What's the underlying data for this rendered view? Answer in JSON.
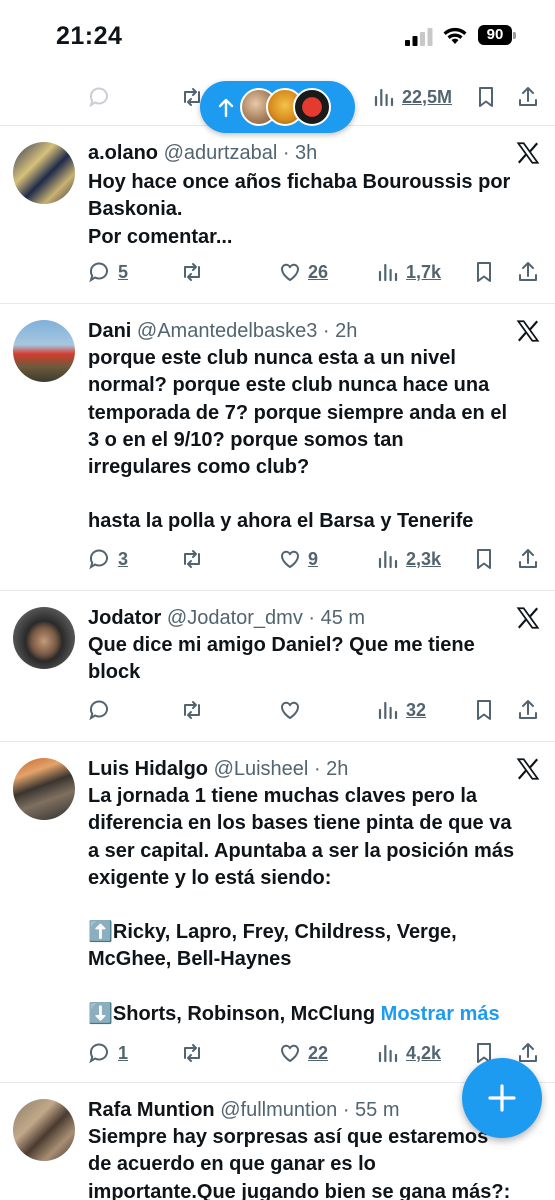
{
  "status_bar": {
    "time": "21:24",
    "battery": "90"
  },
  "prev_tweet": {
    "views": "22,5M"
  },
  "tweets": [
    {
      "name": "a.olano",
      "handle": "@adurtzabal",
      "time": "· 3h",
      "lines": [
        "Hoy hace once años fichaba Bouroussis por",
        "Baskonia.",
        "Por comentar..."
      ],
      "replies": "5",
      "reposts": "",
      "likes": "26",
      "views": "1,7k"
    },
    {
      "name": "Dani",
      "handle": "@Amantedelbaske3",
      "time": "· 2h",
      "lines": [
        "porque este club nunca esta a un nivel",
        "normal? porque este club nunca hace una",
        "temporada de 7? porque siempre anda en el",
        "3 o en el 9/10? porque somos tan",
        "irregulares como club?",
        "",
        "hasta la polla y ahora el Barsa y Tenerife"
      ],
      "replies": "3",
      "reposts": "",
      "likes": "9",
      "views": "2,3k"
    },
    {
      "name": "Jodator",
      "handle": "@Jodator_dmv",
      "time": "· 45 m",
      "lines": [
        "Que dice mi amigo Daniel? Que me tiene",
        "block"
      ],
      "replies": "",
      "reposts": "",
      "likes": "",
      "views": "32"
    },
    {
      "name": "Luis Hidalgo",
      "handle": "@Luisheel",
      "time": "· 2h",
      "lines": [
        "La jornada 1 tiene muchas claves pero la",
        "diferencia en los bases tiene pinta de que va",
        "a ser capital. Apuntaba a ser la posición más",
        "exigente y lo está siendo:",
        "",
        "⬆️Ricky, Lapro, Frey, Childress, Verge,",
        "McGhee, Bell-Haynes",
        "",
        "⬇️Shorts, Robinson, McClung"
      ],
      "show_more": "Mostrar más",
      "replies": "1",
      "reposts": "",
      "likes": "22",
      "views": "4,2k"
    },
    {
      "name": "Rafa Muntion",
      "handle": "@fullmuntion",
      "time": "· 55 m",
      "lines": [
        "Siempre hay sorpresas así que estaremos",
        "de acuerdo en que ganar es lo",
        "importante.Que jugando bien se gana más?:"
      ]
    }
  ],
  "icons": {
    "reply": "reply-icon",
    "repost": "repost-icon",
    "like": "like-icon",
    "views": "views-icon",
    "bookmark": "bookmark-icon",
    "share": "share-icon",
    "x_logo": "x-logo-icon",
    "compose": "compose-plus-icon"
  },
  "colors": {
    "accent": "#1d9bf0",
    "text": "#0f1419",
    "muted": "#536471"
  }
}
